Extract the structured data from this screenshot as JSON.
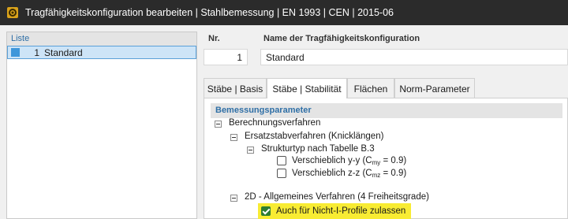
{
  "window": {
    "title": "Tragfähigkeitskonfiguration bearbeiten | Stahlbemessung | EN 1993 | CEN | 2015-06",
    "icon": "configuration-app-icon"
  },
  "list": {
    "header": "Liste",
    "items": [
      {
        "number": "1",
        "name": "Standard",
        "selected": true,
        "color": "#3f97da"
      }
    ]
  },
  "detail": {
    "nr_label": "Nr.",
    "nr_value": "1",
    "name_label": "Name der Tragfähigkeitskonfiguration",
    "name_value": "Standard"
  },
  "tabs": [
    {
      "label": "Stäbe | Basis",
      "active": false
    },
    {
      "label": "Stäbe | Stabilität",
      "active": true
    },
    {
      "label": "Flächen",
      "active": false
    },
    {
      "label": "Norm-Parameter",
      "active": false
    }
  ],
  "section": {
    "title": "Bemessungsparameter"
  },
  "tree": {
    "berechnungsverfahren": "Berechnungsverfahren",
    "ersatzstab": "Ersatzstabverfahren (Knicklängen)",
    "strukturtyp": "Strukturtyp nach Tabelle B.3",
    "opt_yy": {
      "text": "Verschieblich y-y (C",
      "sub": "my",
      "suffix": " = 0.9)",
      "checked": false
    },
    "opt_zz": {
      "text": "Verschieblich z-z (C",
      "sub": "mz",
      "suffix": " = 0.9)",
      "checked": false
    },
    "verfahren_2d": "2D - Allgemeines Verfahren (4 Freiheitsgrade)",
    "nicht_i": {
      "text": "Auch für Nicht-I-Profile zulassen",
      "checked": true
    }
  },
  "colors": {
    "accent_blue": "#2f6fa6",
    "highlight": "#f8ec33",
    "checked_green": "#2e7d32"
  }
}
